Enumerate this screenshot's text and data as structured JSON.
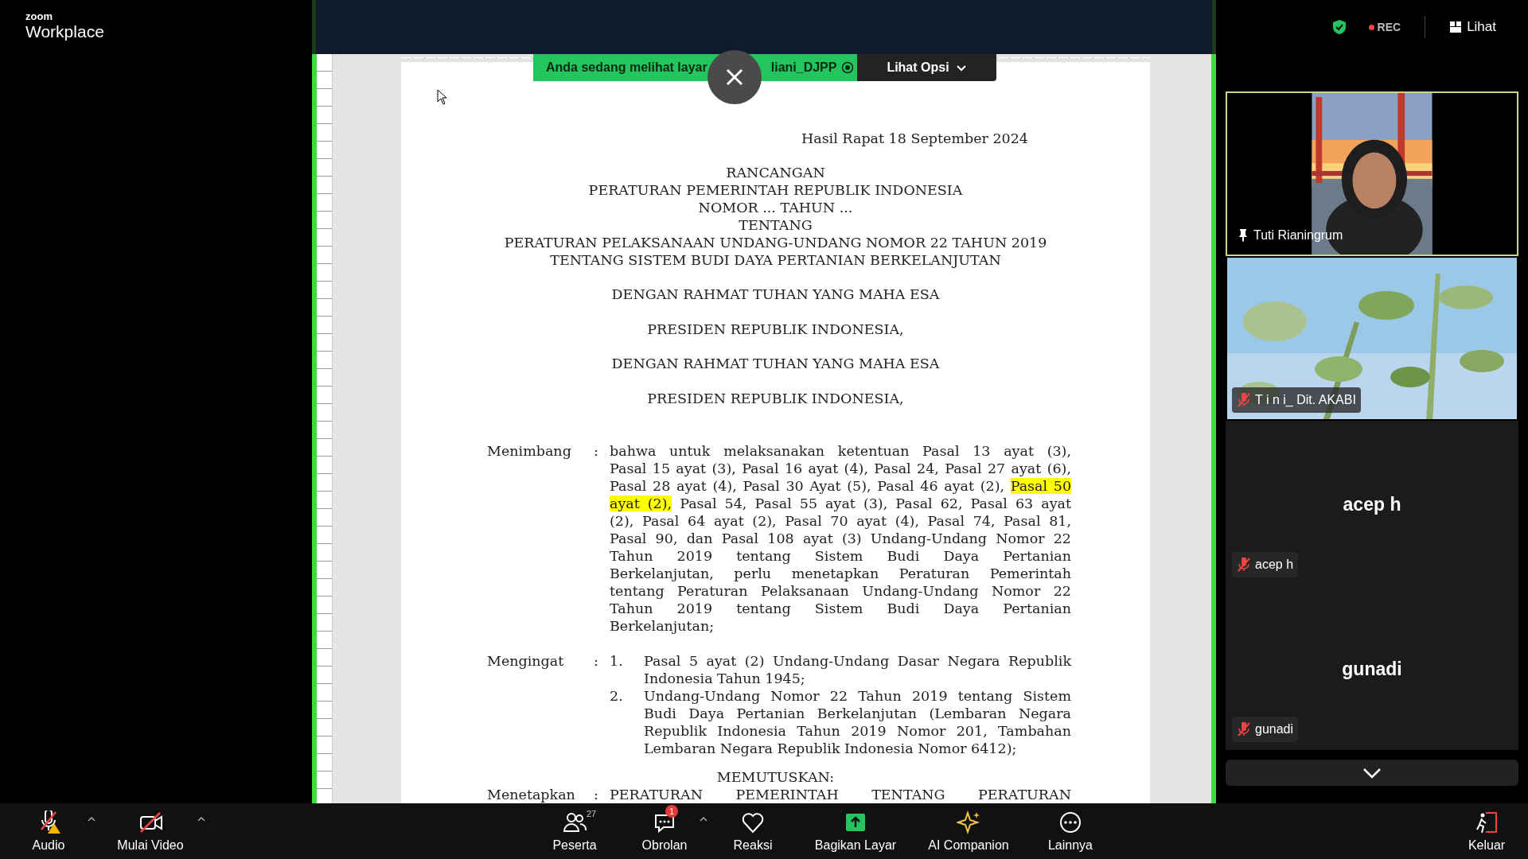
{
  "app": {
    "brand_small": "zoom",
    "brand": "Workplace"
  },
  "header_controls": {
    "recording": {
      "label": "REC",
      "on": true
    },
    "view": {
      "label": "Lihat"
    }
  },
  "share": {
    "banner_text": "Anda sedang melihat layar",
    "presenter": "liani_DJPP",
    "options_label": "Lihat Opsi"
  },
  "document": {
    "header": "Hasil Rapat 18 September 2024",
    "title_lines": [
      "RANCANGAN",
      "PERATURAN PEMERINTAH REPUBLIK INDONESIA",
      "NOMOR ... TAHUN ...",
      "TENTANG",
      "PERATURAN PELAKSANAAN UNDANG-UNDANG NOMOR 22 TAHUN 2019",
      "TENTANG SISTEM BUDI DAYA PERTANIAN BERKELANJUTAN"
    ],
    "headings": [
      "DENGAN RAHMAT TUHAN YANG MAHA ESA",
      "PRESIDEN REPUBLIK INDONESIA,",
      "DENGAN RAHMAT TUHAN YANG MAHA ESA",
      "PRESIDEN REPUBLIK INDONESIA,"
    ],
    "sections": [
      {
        "kind": "paragraph",
        "label": "Menimbang",
        "separator": ":",
        "lines": [
          "bahwa untuk melaksanakan ketentuan Pasal 13 ayat (3),",
          "Pasal 15 ayat (3), Pasal 16 ayat (4), Pasal 24, Pasal 27 ayat (6),",
          {
            "segments": [
              {
                "text": "Pasal 28 ayat (4), Pasal 30 Ayat (5), Pasal 46 ayat (2), ",
                "highlighted": false
              },
              {
                "text": "Pasal 50",
                "highlighted": true
              }
            ]
          },
          {
            "segments": [
              {
                "text": "ayat (2),",
                "highlighted": true
              },
              {
                "text": " Pasal 54, Pasal 55 ayat (3), Pasal 62, Pasal 63 ayat",
                "highlighted": false
              }
            ]
          },
          "(2), Pasal 64 ayat (2), Pasal 70 ayat (4), Pasal 74, Pasal 81,",
          "Pasal 90, dan Pasal 108 ayat (3) Undang-Undang Nomor 22",
          "Tahun 2019 tentang Sistem Budi Daya Pertanian",
          "Berkelanjutan, perlu menetapkan Peraturan Pemerintah",
          "tentang Peraturan Pelaksanaan Undang-Undang Nomor 22",
          "Tahun 2019 tentang Sistem Budi Daya Pertanian",
          "Berkelanjutan;"
        ]
      },
      {
        "kind": "list",
        "label": "Mengingat",
        "separator": ":",
        "items": [
          {
            "number": "1.",
            "lines": [
              "Pasal 5 ayat (2) Undang-Undang Dasar Negara Republik",
              "Indonesia Tahun 1945;"
            ]
          },
          {
            "number": "2.",
            "lines": [
              "Undang-Undang Nomor 22 Tahun 2019 tentang Sistem",
              "Budi Daya Pertanian Berkelanjutan (Lembaran Negara",
              "Republik Indonesia Tahun 2019 Nomor 201, Tambahan",
              "Lembaran Negara Republik Indonesia Nomor 6412);"
            ]
          }
        ]
      }
    ],
    "decision": "MEMUTUSKAN:",
    "closing": {
      "kind": "paragraph",
      "label": "Menetapkan",
      "separator": ":",
      "last_line_justified": true,
      "lines": [
        "PERATURAN PEMERINTAH TENTANG PERATURAN"
      ]
    }
  },
  "participants": [
    {
      "kind": "video",
      "name": "Tuti Rianingrum",
      "pinned": true,
      "muted": false,
      "speaking": true
    },
    {
      "kind": "video",
      "name": "T i n i_ Dit. AKABI",
      "pinned": false,
      "muted": true,
      "speaking": false
    },
    {
      "kind": "avatar",
      "display_name": "acep h",
      "name": "acep h",
      "pinned": false,
      "muted": true,
      "speaking": false
    },
    {
      "kind": "avatar",
      "display_name": "gunadi",
      "name": "gunadi",
      "pinned": false,
      "muted": true,
      "speaking": false
    }
  ],
  "toolbar": [
    {
      "kind": "audio",
      "label": "Audio",
      "menu": true
    },
    {
      "kind": "video",
      "label": "Mulai Video",
      "menu": true
    },
    {
      "kind": "participants",
      "label": "Peserta",
      "count": "27",
      "menu": false
    },
    {
      "kind": "chat",
      "label": "Obrolan",
      "badge": "1",
      "menu": true
    },
    {
      "kind": "reactions",
      "label": "Reaksi",
      "menu": false
    },
    {
      "kind": "share",
      "label": "Bagikan Layar",
      "menu": false
    },
    {
      "kind": "ai",
      "label": "AI Companion",
      "menu": false
    },
    {
      "kind": "more",
      "label": "Lainnya",
      "menu": false
    },
    {
      "kind": "leave",
      "label": "Keluar",
      "menu": false
    }
  ]
}
